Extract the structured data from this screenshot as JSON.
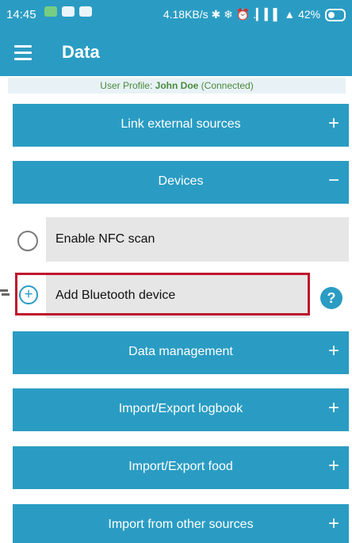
{
  "status_bar": {
    "time": "14:45",
    "right_text": "4.18KB/s ✱ ❄ ⏰ .▎▍▌ ▲ 42%"
  },
  "app_bar": {
    "title": "Data"
  },
  "profile": {
    "prefix": "User Profile: ",
    "name": "John Doe",
    "status": " (Connected)"
  },
  "sections": [
    {
      "label": "Link external sources",
      "sign": "+"
    },
    {
      "label": "Devices",
      "sign": "−"
    },
    {
      "label": "Data management",
      "sign": "+"
    },
    {
      "label": "Import/Export logbook",
      "sign": "+"
    },
    {
      "label": "Import/Export food",
      "sign": "+"
    },
    {
      "label": "Import from other sources",
      "sign": "+"
    }
  ],
  "devices": {
    "nfc_label": "Enable NFC scan",
    "bluetooth_label": "Add Bluetooth device",
    "help_symbol": "?"
  },
  "icons": {
    "menu": "hamburger-menu-icon",
    "nfc_toggle": "radio-icon",
    "add": "add-circle-icon",
    "help": "help-icon"
  },
  "colors": {
    "primary": "#2a9cc3",
    "highlight_border": "#c0162d",
    "row_background": "#e6e6e6",
    "profile_text": "#4a8a3c"
  }
}
